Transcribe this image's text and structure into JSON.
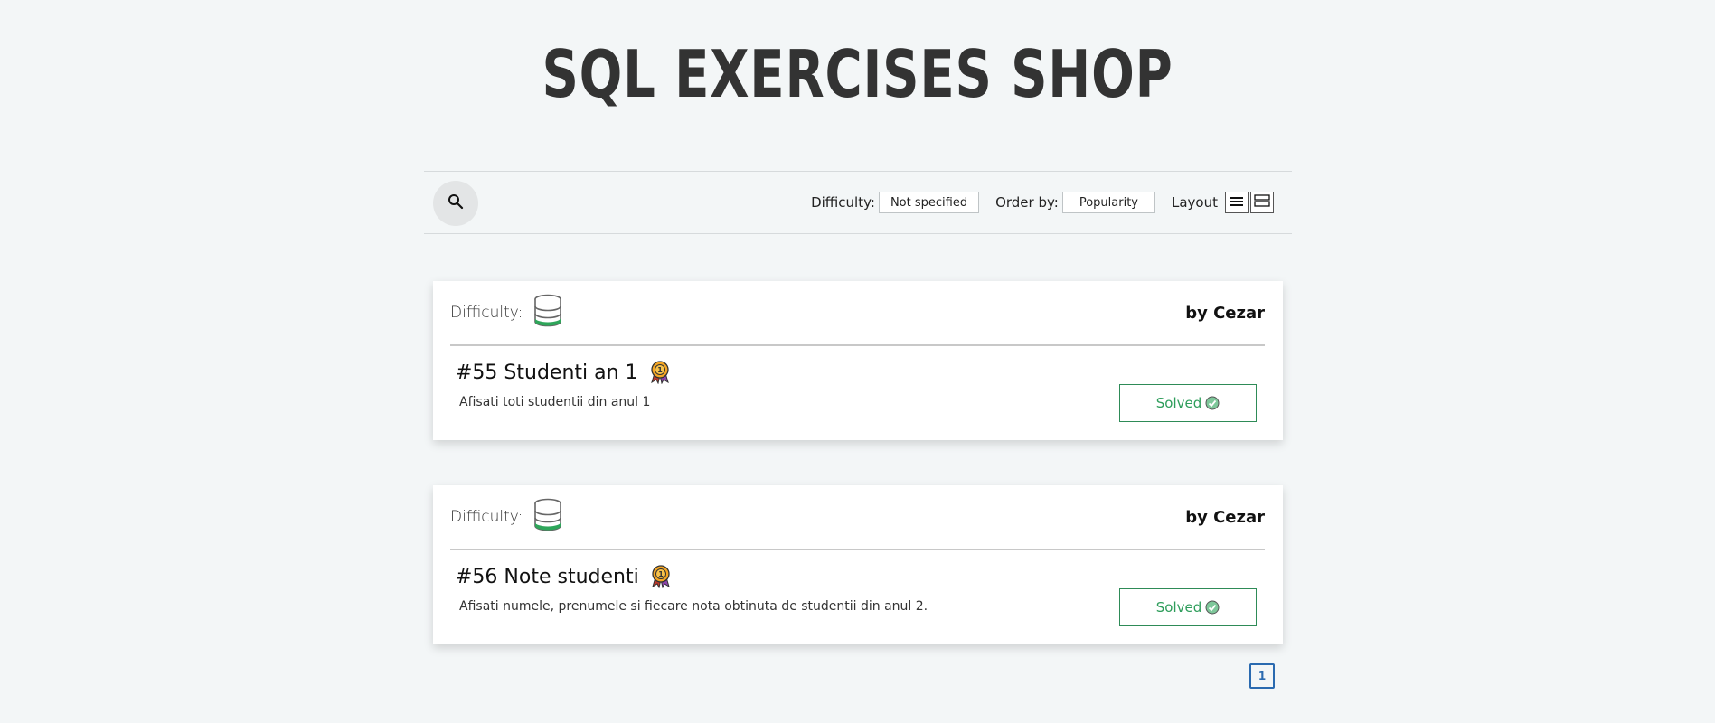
{
  "header": {
    "title": "SQL EXERCISES SHOP"
  },
  "toolbar": {
    "search_icon": "search-icon",
    "difficulty_label": "Difficulty:",
    "difficulty_value": "Not specified",
    "order_label": "Order by:",
    "order_value": "Popularity",
    "layout_label": "Layout",
    "layout_icons": [
      "list-layout-icon",
      "card-layout-icon"
    ]
  },
  "exercises": [
    {
      "difficulty_label": "Difficulty:",
      "author": "by Cezar",
      "title": "#55 Studenti an 1",
      "description": "Afisati toti studentii din anul 1",
      "status": "Solved",
      "difficulty_icon": "database-icon",
      "badge_icon": "medal-icon"
    },
    {
      "difficulty_label": "Difficulty:",
      "author": "by Cezar",
      "title": "#56 Note studenti",
      "description": "Afisati numele, prenumele si fiecare nota obtinuta de studentii din anul 2.",
      "status": "Solved",
      "difficulty_icon": "database-icon",
      "badge_icon": "medal-icon"
    }
  ],
  "pagination": {
    "current": "1"
  },
  "colors": {
    "accent_green": "#2e9d5b",
    "pager_blue": "#2a6ab0",
    "background": "#f3f6f7"
  }
}
